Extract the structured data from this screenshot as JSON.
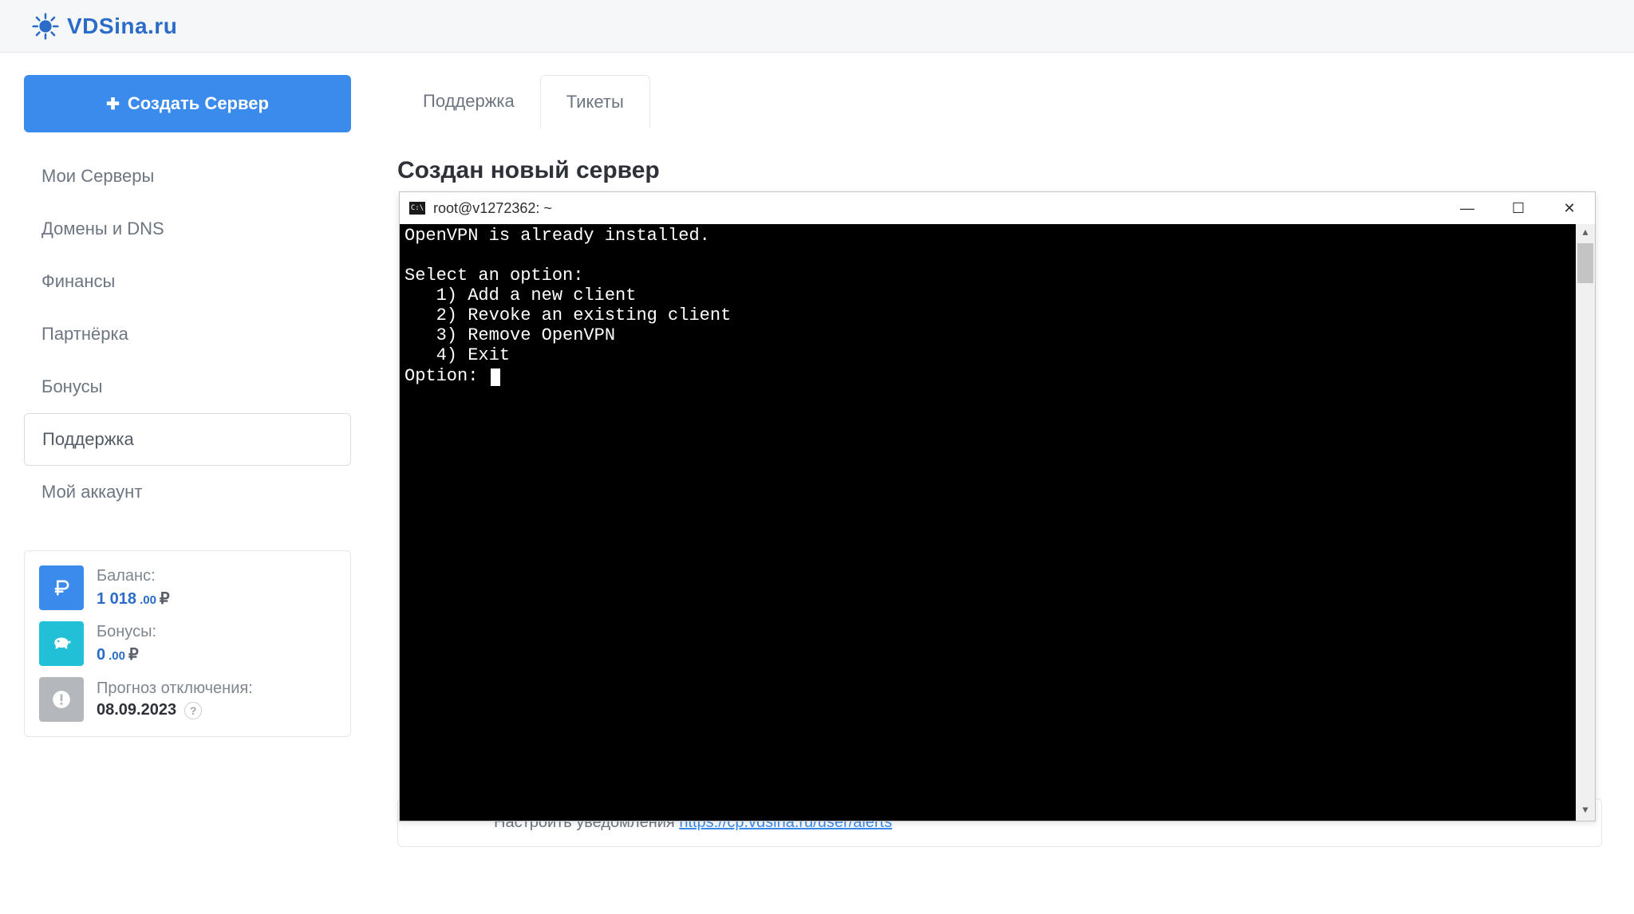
{
  "header": {
    "brand": "VDSina.ru"
  },
  "sidebar": {
    "create_label": "Создать Сервер",
    "items": [
      {
        "label": "Мои Серверы"
      },
      {
        "label": "Домены и DNS"
      },
      {
        "label": "Финансы"
      },
      {
        "label": "Партнёрка"
      },
      {
        "label": "Бонусы"
      },
      {
        "label": "Поддержка"
      },
      {
        "label": "Мой аккаунт"
      }
    ],
    "balance": {
      "label": "Баланс:",
      "int": "1 018",
      "cents": ".00",
      "currency": "₽"
    },
    "bonuses": {
      "label": "Бонусы:",
      "int": "0",
      "cents": ".00",
      "currency": "₽"
    },
    "forecast": {
      "label": "Прогноз отключения:",
      "value": "08.09.2023",
      "help": "?"
    }
  },
  "main": {
    "tabs": [
      {
        "label": "Поддержка"
      },
      {
        "label": "Тикеты"
      }
    ],
    "title": "Создан новый сервер",
    "hidden_text": "Настроить уведомления ",
    "hidden_link": "https://cp.vdsina.ru/user/alerts"
  },
  "terminal": {
    "title": "root@v1272362: ~",
    "icon_text": "C:\\",
    "lines": [
      "OpenVPN is already installed.",
      "",
      "Select an option:",
      "   1) Add a new client",
      "   2) Revoke an existing client",
      "   3) Remove OpenVPN",
      "   4) Exit",
      "Option: "
    ],
    "controls": {
      "minimize": "—",
      "maximize": "☐",
      "close": "✕"
    },
    "scroll_up": "▲",
    "scroll_down": "▼"
  }
}
